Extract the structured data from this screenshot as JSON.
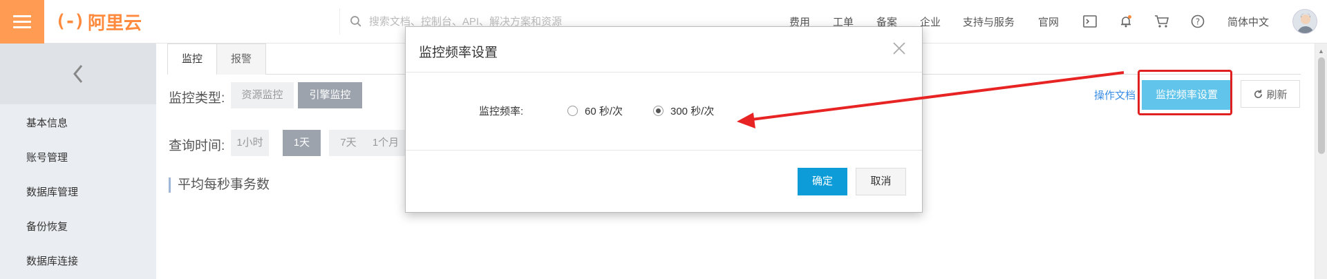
{
  "topbar": {
    "logo_text": "阿里云",
    "logo_mark": "(-)",
    "search_placeholder": "搜索文档、控制台、API、解决方案和资源",
    "nav": [
      "费用",
      "工单",
      "备案",
      "企业",
      "支持与服务",
      "官网"
    ],
    "lang": "简体中文",
    "icons": [
      "terminal-icon",
      "bell-icon",
      "cart-icon",
      "help-icon"
    ]
  },
  "sidebar": {
    "items": [
      "基本信息",
      "账号管理",
      "数据库管理",
      "备份恢复",
      "数据库连接"
    ]
  },
  "main": {
    "tabs": [
      "监控",
      "报警"
    ],
    "monitor_type_label": "监控类型:",
    "monitor_types": [
      "资源监控",
      "引擎监控"
    ],
    "query_time_label": "查询时间:",
    "time_ranges": [
      "1小时",
      "1天",
      "7天",
      "1个月"
    ],
    "section_title": "平均每秒事务数",
    "op_doc": "操作文档",
    "monitor_freq_button": "监控频率设置",
    "refresh_button": "刷新"
  },
  "modal": {
    "title": "监控频率设置",
    "freq_label": "监控频率:",
    "options": [
      "60 秒/次",
      "300 秒/次"
    ],
    "selected_option": "300 秒/次",
    "ok": "确定",
    "cancel": "取消"
  },
  "colors": {
    "brand_orange": "#ff9b52",
    "primary_blue": "#0d9cd8",
    "light_blue_button": "#61c4ea",
    "annotation_red": "#e02020"
  }
}
